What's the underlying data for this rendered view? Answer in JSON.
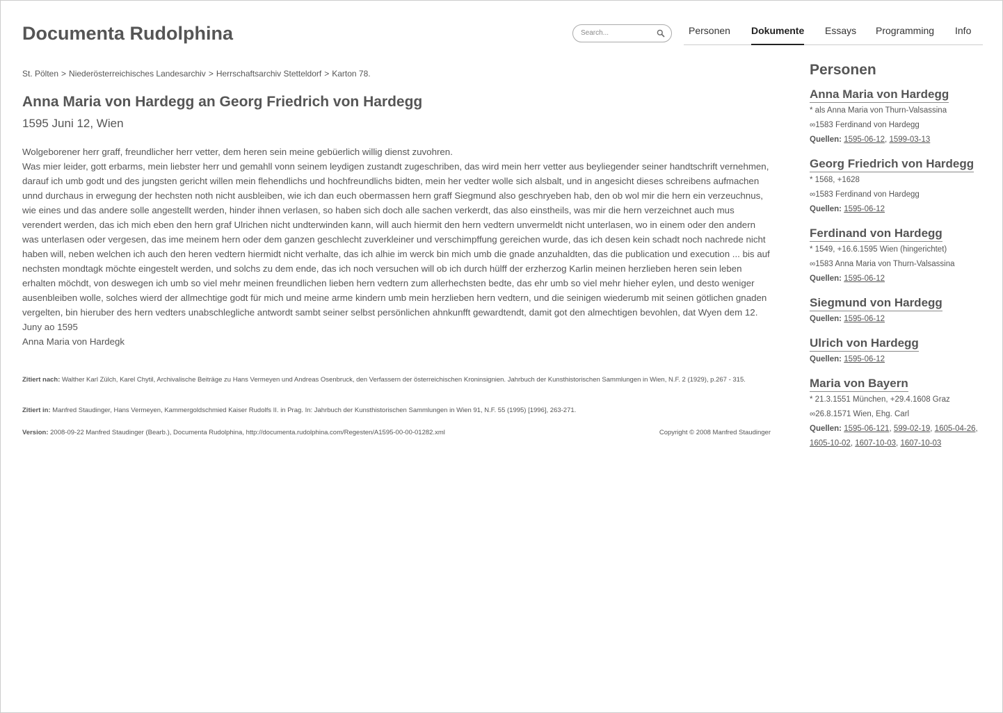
{
  "site": {
    "title": "Documenta Rudolphina"
  },
  "search": {
    "placeholder": "Search..."
  },
  "nav": [
    {
      "label": "Personen"
    },
    {
      "label": "Dokumente",
      "active": true
    },
    {
      "label": "Essays"
    },
    {
      "label": "Programming"
    },
    {
      "label": "Info"
    }
  ],
  "breadcrumb": [
    "St. Pölten",
    "Niederösterreichisches Landesarchiv",
    "Herrschaftsarchiv Stetteldorf",
    "Karton 78."
  ],
  "document": {
    "title": "Anna Maria von Hardegg an Georg Friedrich von Hardegg",
    "date": "1595 Juni 12, Wien",
    "greeting": "Wolgeborener herr graff, freundlicher herr vetter, dem heren sein meine gebüerlich willig dienst zuvohren.",
    "body": "Was mier leider, gott erbarms, mein liebster herr und gemahll vonn seinem leydigen zustandt zugeschriben, das wird mein herr vetter aus beyliegender seiner handtschrift vernehmen, darauf ich umb godt und des jungsten gericht willen mein flehendlichs und hochfreundlichs bidten, mein her vedter wolle sich alsbalt, und in angesicht dieses schreibens aufmachen unnd durchaus in erwegung der hechsten noth nicht ausbleiben, wie ich dan euch obermassen hern graff Siegmund also geschryeben hab, den ob wol mir die hern ein verzeuchnus, wie eines und das andere solle angestellt werden, hinder ihnen verlasen, so haben sich doch alle sachen verkerdt, das also einstheils, was mir die hern verzeichnet auch mus verendert werden, das ich mich eben den hern graf Ulrichen nicht undterwinden kann, will auch hiermit den hern vedtern unvermeldt nicht unterlasen, wo in einem oder den andern was unterlasen oder vergesen, das ime meinem hern oder dem ganzen geschlecht zuverkleiner und verschimpffung gereichen wurde, das ich desen kein schadt noch nachrede nicht haben will, neben welchen ich auch den heren vedtern hiermidt nicht verhalte, das ich alhie im werck bin mich umb die gnade anzuhaldten, das die publication und execution ... bis auf nechsten mondtagk möchte eingestelt werden, und solchs zu dem ende, das ich noch versuchen will ob ich durch hülff der erzherzog Karlin meinen herzlieben heren sein leben erhalten möchdt, von deswegen ich umb so viel mehr meinen freundlichen lieben hern vedtern zum allerhechsten bedte, das ehr umb so viel mehr hieher eylen, und desto weniger ausenbleiben wolle, solches wierd der allmechtige godt für mich und meine arme kindern umb mein herzlieben hern vedtern, und die seinigen wiederumb mit seinen götlichen gnaden vergelten, bin hieruber des hern vedters unabschlegliche antwordt sambt seiner selbst persönlichen ahnkunfft gewardtendt, damit got den almechtigen bevohlen, dat Wyen dem 12. Juny ao 1595",
    "signature": "Anna Maria von Hardegk"
  },
  "citations": {
    "cited_after_label": "Zitiert nach:",
    "cited_after_text": "Walther Karl Zülch, Karel Chytil, Archivalische Beiträge zu Hans Vermeyen und Andreas Osenbruck, den Verfassern der österreichischen Kroninsignien. Jahrbuch der Kunsthistorischen Sammlungen in Wien, N.F. 2 (1929), p.267 - 315.",
    "cited_in_label": "Zitiert in:",
    "cited_in_text": "Manfred Staudinger, Hans Vermeyen, Kammergoldschmied Kaiser Rudolfs II. in Prag. In: Jahrbuch der Kunsthistorischen Sammlungen in Wien 91, N.F. 55 (1995) [1996], 263-271.",
    "version_label": "Version:",
    "version_text": "2008-09-22 Manfred Staudinger (Bearb.), Documenta Rudolphina, http://documenta.rudolphina.com/Regesten/A1595-00-00-01282.xml",
    "copyright": "Copyright © 2008 Manfred Staudinger"
  },
  "sidebar": {
    "title": "Personen",
    "sources_label": "Quellen:",
    "persons": [
      {
        "name": "Anna Maria von Hardegg",
        "info": [
          "* als Anna Maria von Thurn-Valsassina",
          "∞1583 Ferdinand von Hardegg"
        ],
        "sources": [
          "1595-06-12",
          "1599-03-13"
        ]
      },
      {
        "name": "Georg Friedrich von Hardegg",
        "info": [
          "* 1568, +1628",
          "∞1583 Ferdinand von Hardegg"
        ],
        "sources": [
          "1595-06-12"
        ]
      },
      {
        "name": "Ferdinand von Hardegg",
        "info": [
          "* 1549, +16.6.1595 Wien (hingerichtet)",
          "∞1583 Anna Maria von Thurn-Valsassina"
        ],
        "sources": [
          "1595-06-12"
        ]
      },
      {
        "name": "Siegmund von Hardegg",
        "info": [],
        "sources": [
          "1595-06-12"
        ]
      },
      {
        "name": "Ulrich von Hardegg",
        "info": [],
        "sources": [
          "1595-06-12"
        ]
      },
      {
        "name": "Maria von Bayern",
        "info": [
          "* 21.3.1551 München, +29.4.1608 Graz",
          "∞26.8.1571 Wien, Ehg. Carl"
        ],
        "sources": [
          "1595-06-121",
          "599-02-19",
          "1605-04-26",
          "1605-10-02",
          "1607-10-03",
          "1607-10-03"
        ]
      }
    ]
  }
}
